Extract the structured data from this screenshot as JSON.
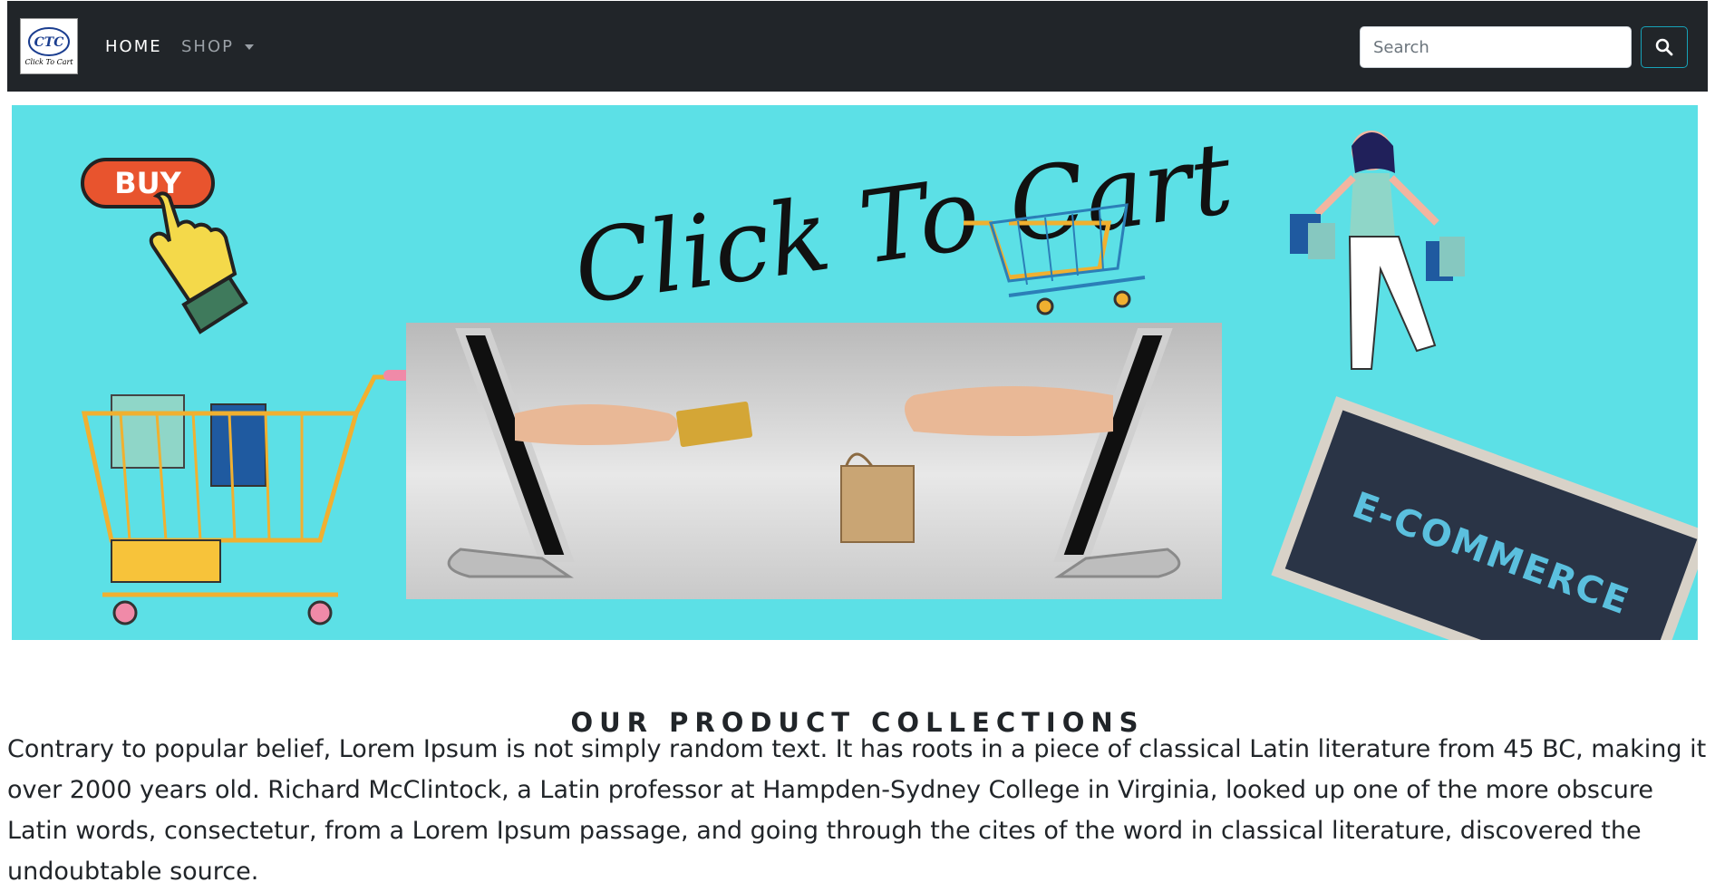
{
  "navbar": {
    "logo_text": "CTC",
    "logo_subtext": "Click To Cart",
    "links": [
      {
        "label": "HOME"
      },
      {
        "label": "SHOP"
      }
    ],
    "search": {
      "placeholder": "Search",
      "value": ""
    },
    "search_button_icon": "search-icon"
  },
  "banner": {
    "script_title": "Click To Cart",
    "buy_button_label": "BUY",
    "board_text": "E-COMMERCE",
    "background_color": "#5ce0e6"
  },
  "content": {
    "section_title": "OUR PRODUCT COLLECTIONS",
    "paragraph": "Contrary to popular belief, Lorem Ipsum is not simply random text. It has roots in a piece of classical Latin literature from 45 BC, making it over 2000 years old. Richard McClintock, a Latin professor at Hampden-Sydney College in Virginia, looked up one of the more obscure Latin words, consectetur, from a Lorem Ipsum passage, and going through the cites of the word in classical literature, discovered the undoubtable source."
  },
  "colors": {
    "navbar_bg": "#212529",
    "accent": "#17a2b8"
  }
}
